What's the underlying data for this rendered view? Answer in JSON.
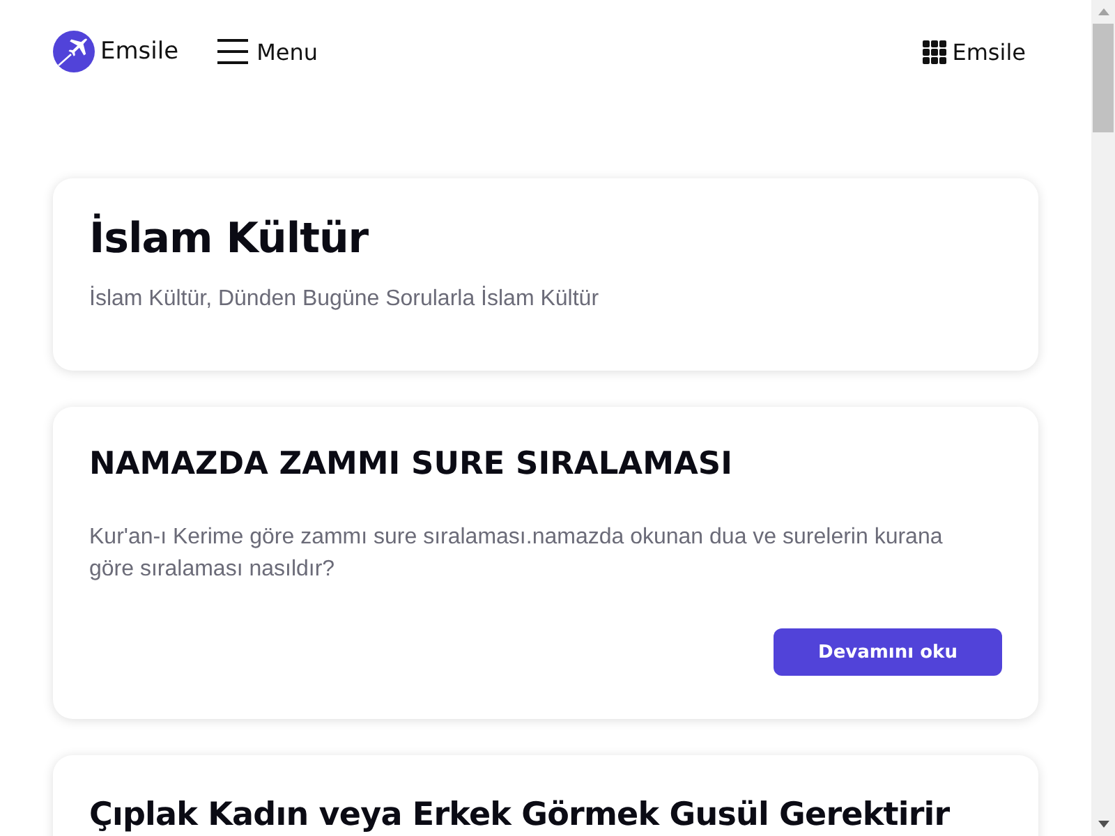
{
  "header": {
    "logo": "Emsile",
    "menu": "Menu",
    "apps_link": "Emsile"
  },
  "intro": {
    "title": "İslam Kültür",
    "subtitle": "İslam Kültür, Dünden Bugüne Sorularla İslam Kültür"
  },
  "posts": [
    {
      "title": "NAMAZDA ZAMMI SURE SIRALAMASI",
      "excerpt": "Kur'an-ı Kerime göre zammı sure sıralaması.namazda okunan dua ve surelerin kurana göre sıralaması nasıldır?",
      "button": "Devamını oku"
    },
    {
      "title": "Çıplak Kadın veya Erkek Görmek Gusül Gerektirir"
    }
  ]
}
